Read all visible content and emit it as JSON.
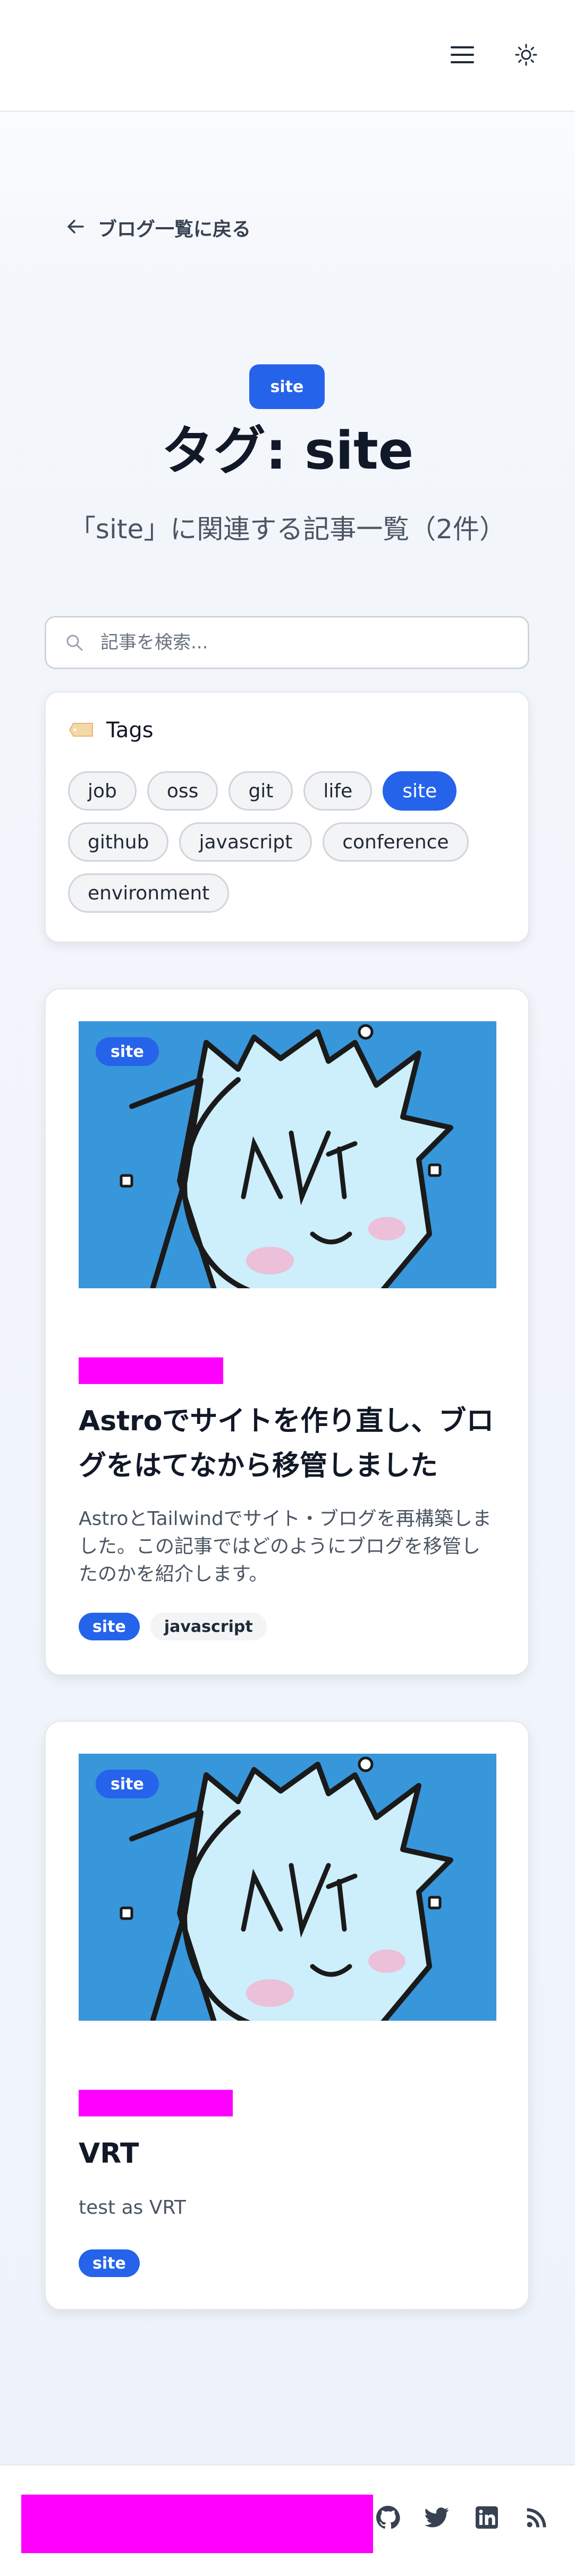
{
  "header": {
    "menu_icon": "hamburger-menu-icon",
    "theme_icon": "sun-theme-toggle-icon"
  },
  "back_link": {
    "label": "ブログ一覧に戻る",
    "icon": "arrow-left-icon"
  },
  "hero": {
    "badge": "site",
    "title": "タグ: site",
    "subtitle": "「site」に関連する記事一覧（2件）"
  },
  "search": {
    "placeholder": "記事を検索...",
    "value": "",
    "icon": "search-icon"
  },
  "tags": {
    "heading": "Tags",
    "icon": "tag-label-icon",
    "items": [
      {
        "label": "job",
        "active": false
      },
      {
        "label": "oss",
        "active": false
      },
      {
        "label": "git",
        "active": false
      },
      {
        "label": "life",
        "active": false
      },
      {
        "label": "site",
        "active": true
      },
      {
        "label": "github",
        "active": false
      },
      {
        "label": "javascript",
        "active": false
      },
      {
        "label": "conference",
        "active": false
      },
      {
        "label": "environment",
        "active": false
      }
    ]
  },
  "posts": [
    {
      "badge": "site",
      "title": "Astroでサイトを作り直し、ブログをはてなから移管しました",
      "description": "AstroとTailwindでサイト・ブログを再構築しました。この記事ではどのようにブログを移管したのかを紹介します。",
      "tags": [
        "site",
        "javascript"
      ]
    },
    {
      "badge": "site",
      "title": "VRT",
      "description": "test as VRT",
      "tags": [
        "site"
      ]
    }
  ],
  "footer": {
    "icons": [
      "github-icon",
      "twitter-icon",
      "linkedin-icon",
      "rss-icon"
    ]
  },
  "colors": {
    "accent": "#2563eb",
    "placeholder_block": "#ff00ff",
    "thumbnail_bg": "#3896db"
  }
}
